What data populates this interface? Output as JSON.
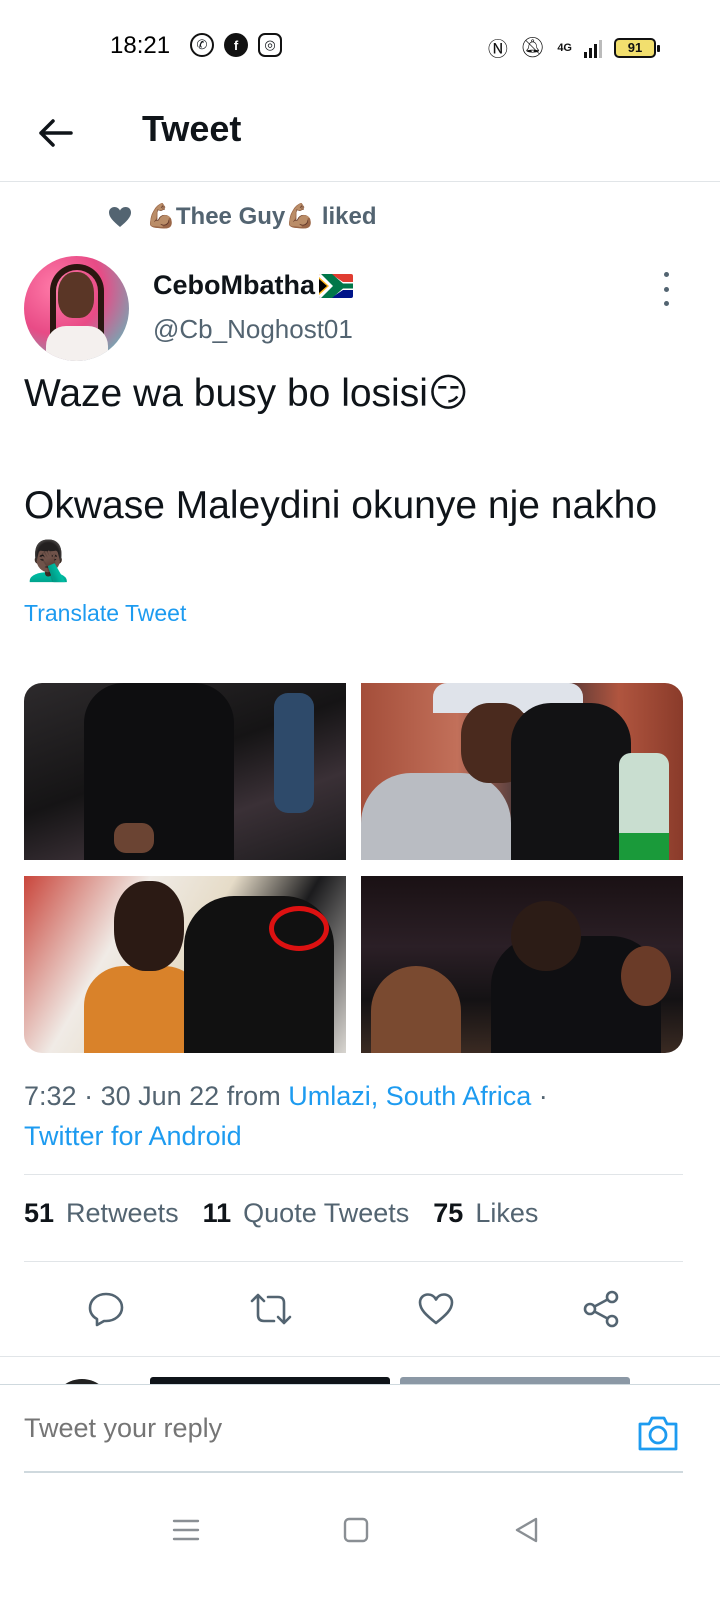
{
  "status_bar": {
    "time": "18:21",
    "battery": "91",
    "network": "4G"
  },
  "header": {
    "title": "Tweet"
  },
  "social_context": {
    "emoji_left": "💪🏽",
    "name": "Thee Guy",
    "emoji_right": "💪🏽",
    "action": "liked"
  },
  "tweet": {
    "display_name": "CeboMbatha",
    "username": "@Cb_Noghost01",
    "text": "Waze wa busy bo losisi😏\n\nOkwase Maleydini okunye nje nakho 🤦🏿‍♂️",
    "translate_label": "Translate Tweet",
    "time": "7:32",
    "date": "30 Jun 22",
    "from_label": "from",
    "location": "Umlazi, South Africa",
    "source": "Twitter for Android"
  },
  "stats": {
    "retweets_count": "51",
    "retweets_label": "Retweets",
    "quotes_count": "11",
    "quotes_label": "Quote Tweets",
    "likes_count": "75",
    "likes_label": "Likes"
  },
  "reply": {
    "placeholder": "Tweet your reply"
  },
  "colors": {
    "accent": "#1d9bf0",
    "text_primary": "#0f1419",
    "text_secondary": "#536471"
  }
}
